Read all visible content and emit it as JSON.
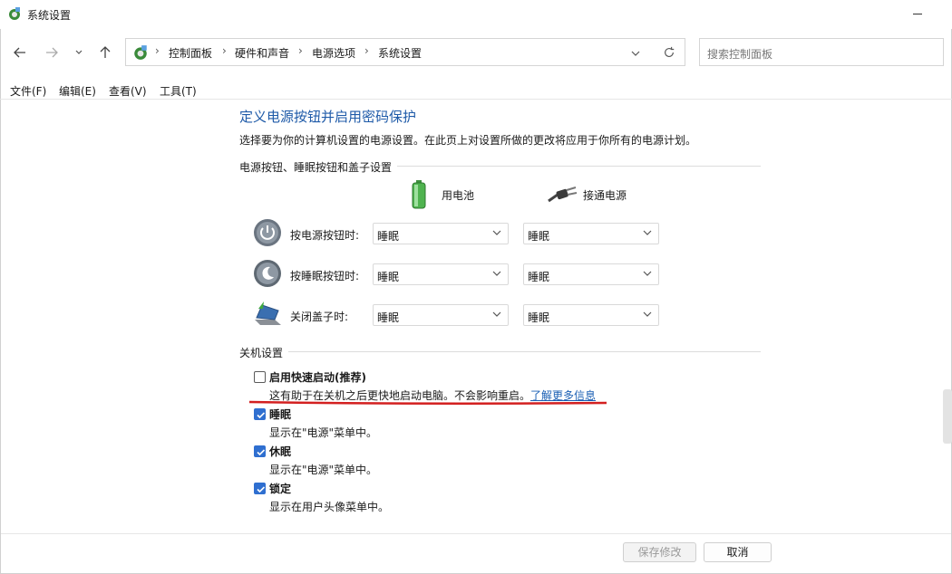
{
  "window": {
    "title": "系统设置"
  },
  "nav": {
    "breadcrumbs": [
      "控制面板",
      "硬件和声音",
      "电源选项",
      "系统设置"
    ],
    "search_placeholder": "搜索控制面板"
  },
  "menu": [
    "文件(F)",
    "编辑(E)",
    "查看(V)",
    "工具(T)"
  ],
  "page": {
    "title": "定义电源按钮并启用密码保护",
    "description": "选择要为你的计算机设置的电源设置。在此页上对设置所做的更改将应用于你所有的电源计划。"
  },
  "power_buttons": {
    "group_label": "电源按钮、睡眠按钮和盖子设置",
    "columns": [
      "用电池",
      "接通电源"
    ],
    "rows": [
      {
        "label": "按电源按钮时:",
        "icon": "power-button-icon",
        "battery": "睡眠",
        "plugged": "睡眠"
      },
      {
        "label": "按睡眠按钮时:",
        "icon": "sleep-button-icon",
        "battery": "睡眠",
        "plugged": "睡眠"
      },
      {
        "label": "关闭盖子时:",
        "icon": "laptop-lid-icon",
        "battery": "睡眠",
        "plugged": "睡眠"
      }
    ]
  },
  "shutdown": {
    "group_label": "关机设置",
    "options": [
      {
        "title": "启用快速启动(推荐)",
        "desc": "这有助于在关机之后更快地启动电脑。不会影响重启。",
        "link": "了解更多信息",
        "checked": false
      },
      {
        "title": "睡眠",
        "desc": "显示在\"电源\"菜单中。",
        "checked": true
      },
      {
        "title": "休眠",
        "desc": "显示在\"电源\"菜单中。",
        "checked": true
      },
      {
        "title": "锁定",
        "desc": "显示在用户头像菜单中。",
        "checked": true
      }
    ]
  },
  "footer": {
    "save": "保存修改",
    "cancel": "取消"
  },
  "colors": {
    "accent": "#2f6fd0",
    "title": "#1e5aa8",
    "annotation": "#d32020"
  }
}
